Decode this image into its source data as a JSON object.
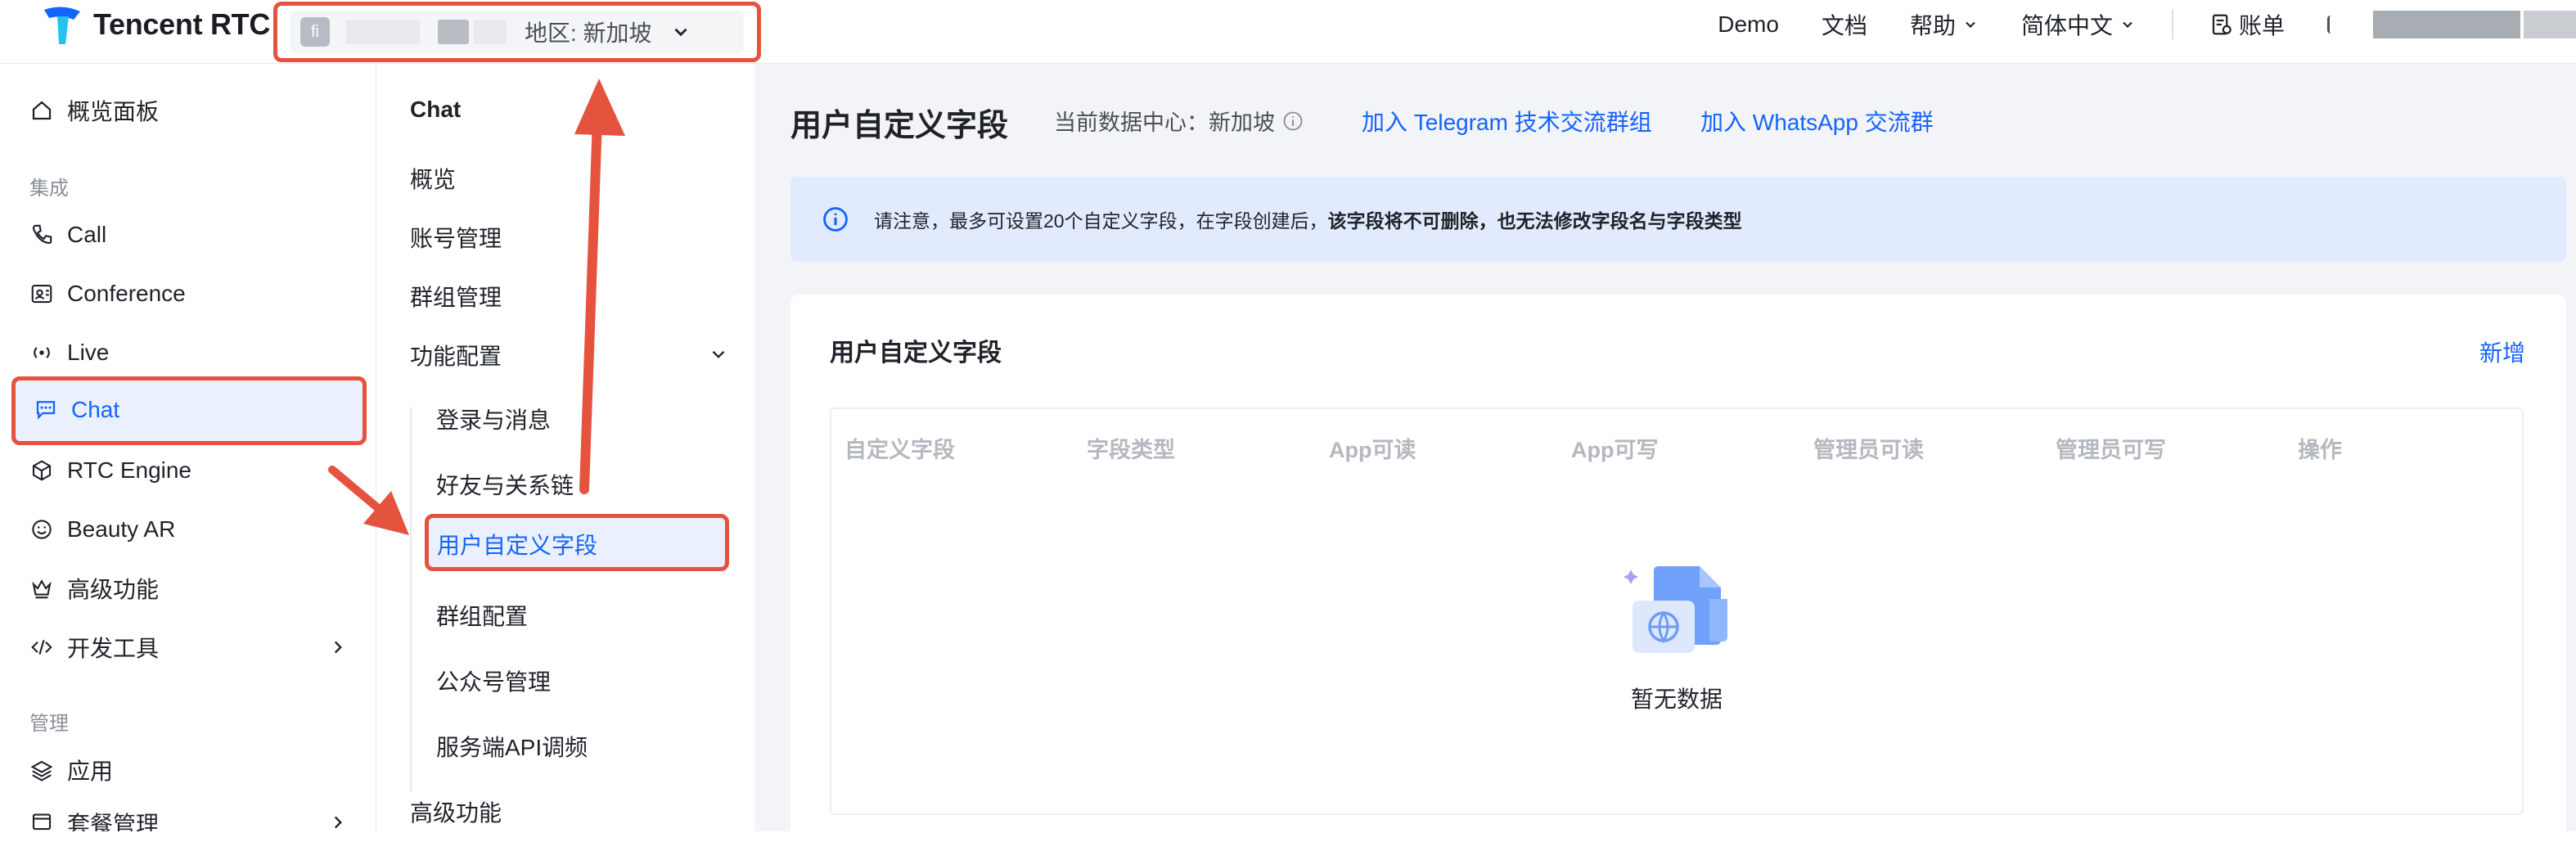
{
  "brand": {
    "name": "Tencent RTC"
  },
  "app_selector": {
    "badge": "fi",
    "region": "地区: 新加坡"
  },
  "topnav": {
    "demo": "Demo",
    "docs": "文档",
    "help": "帮助",
    "language": "简体中文",
    "billing": "账单"
  },
  "sidebar": {
    "overview": "概览面板",
    "group_integrate": "集成",
    "items": [
      "Call",
      "Conference",
      "Live",
      "Chat",
      "RTC Engine",
      "Beauty AR",
      "高级功能",
      "开发工具"
    ],
    "group_manage": "管理",
    "manage_items": [
      "应用",
      "套餐管理"
    ]
  },
  "subnav": {
    "title": "Chat",
    "overview": "概览",
    "account": "账号管理",
    "group": "群组管理",
    "feature_config": "功能配置",
    "children": [
      "登录与消息",
      "好友与关系链",
      "用户自定义字段",
      "群组配置",
      "公众号管理",
      "服务端API调频"
    ],
    "advanced": "高级功能"
  },
  "main": {
    "title": "用户自定义字段",
    "datacenter_label": "当前数据中心：",
    "datacenter_value": "新加坡",
    "link_telegram": "加入 Telegram 技术交流群组",
    "link_whatsapp": "加入 WhatsApp 交流群",
    "notice_prefix": "请注意，最多可设置20个自定义字段，在字段创建后，",
    "notice_bold": "该字段将不可删除，也无法修改字段名与字段类型",
    "card_title": "用户自定义字段",
    "add_label": "新增",
    "columns": [
      "自定义字段",
      "字段类型",
      "App可读",
      "App可写",
      "管理员可读",
      "管理员可写",
      "操作"
    ],
    "empty_text": "暂无数据"
  },
  "colors": {
    "accent": "#1664ff",
    "highlight": "#e5533f",
    "notice_bg": "#e2ebfd"
  }
}
